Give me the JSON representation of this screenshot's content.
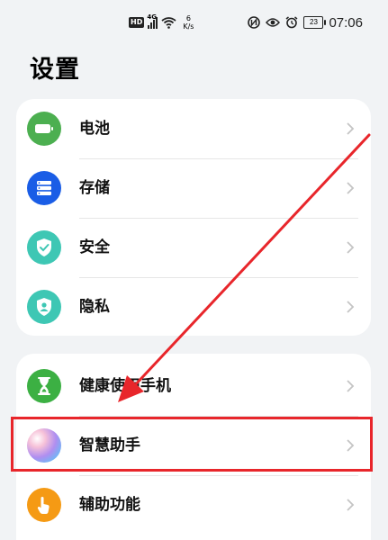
{
  "status_bar": {
    "hd": "HD",
    "network": "4G",
    "speed_value": "6",
    "speed_unit": "K/s",
    "battery": "23",
    "time": "07:06"
  },
  "page_title": "设置",
  "group1": [
    {
      "label": "电池",
      "icon": "battery-icon",
      "color": "#4caf50"
    },
    {
      "label": "存储",
      "icon": "storage-icon",
      "color": "#1a5de6"
    },
    {
      "label": "安全",
      "icon": "security-shield-icon",
      "color": "#3ec7b4"
    },
    {
      "label": "隐私",
      "icon": "privacy-icon",
      "color": "#3ec7b4"
    }
  ],
  "group2": [
    {
      "label": "健康使用手机",
      "icon": "hourglass-icon",
      "color": "#3cb043"
    },
    {
      "label": "智慧助手",
      "icon": "smart-assistant-icon",
      "color": "#c9a0e8"
    },
    {
      "label": "辅助功能",
      "icon": "accessibility-hand-icon",
      "color": "#f59a14"
    }
  ],
  "annotation": {
    "arrow_color": "#e8262b",
    "box_color": "#e8262b"
  }
}
